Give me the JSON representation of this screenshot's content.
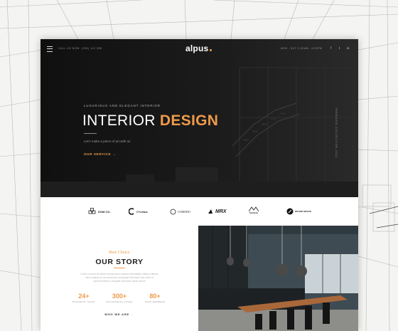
{
  "header": {
    "call": "CALL US NOW: (234) 112 355",
    "logo": "alpus",
    "hours": "MON - SAT: 9.00AM - 6.00PM",
    "social": [
      "f",
      "t",
      "in"
    ]
  },
  "hero": {
    "tagline": "LUXURIOUS AND ELEGANT INTERIOR",
    "title_plain": "INTERIOR",
    "title_accent": "DESIGN",
    "subtitle": "Let's make a piece of art with us",
    "cta": "OUR SERVICE",
    "cta_arrow": "→",
    "vertical": "TRENDING COLLECTION 2022"
  },
  "partners": [
    {
      "name": "DOM CO.",
      "icon": "cubes-icon"
    },
    {
      "name": "C+cetus",
      "icon": "c-plus-icon"
    },
    {
      "name": "COMODO",
      "icon": "circle-logo-icon"
    },
    {
      "name": "MRX",
      "icon": "mrx-icon"
    },
    {
      "name": "MASSAS",
      "icon": "mountain-icon"
    },
    {
      "name": "ROUND GROUP",
      "icon": "round-icon"
    }
  ],
  "story": {
    "kicker": "Best Choice",
    "heading": "OUR STORY",
    "para1": "Lorem ut enim ad minim veniam quis nostrud exercitation ullamco laboris",
    "para2": "nisi ut aliquip ex ea commodo consequat duis aute irure dolor in",
    "para3": "reprehenderit in voluptate velit esse cillum dolore",
    "stats": [
      {
        "num": "24+",
        "label": "BUSINESS YEARS"
      },
      {
        "num": "300+",
        "label": "SUCCESSFUL CASES"
      },
      {
        "num": "80+",
        "label": "TEAM MEMBERS"
      }
    ],
    "cta": "WHO WE ARE",
    "cta_arrow": "→"
  },
  "colors": {
    "accent": "#ef9a4a",
    "dark": "#141414"
  }
}
